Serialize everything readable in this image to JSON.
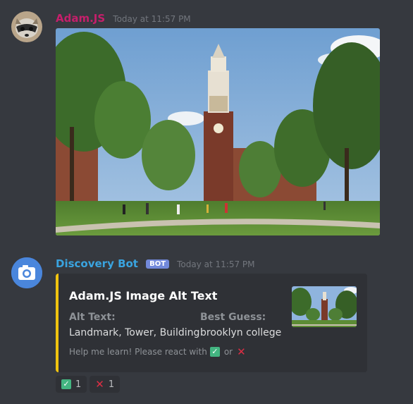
{
  "messages": [
    {
      "username": "Adam.JS",
      "username_color": "#c51f6b",
      "timestamp": "Today at 11:57 PM"
    },
    {
      "username": "Discovery Bot",
      "username_color": "#3aa4e0",
      "badge": "BOT",
      "timestamp": "Today at 11:57 PM",
      "embed": {
        "accent_color": "#f1c40f",
        "title": "Adam.JS Image Alt Text",
        "fields": [
          {
            "name": "Alt Text:",
            "value": "Landmark, Tower, Building"
          },
          {
            "name": "Best Guess:",
            "value": "brooklyn college"
          }
        ],
        "footer_text": "Help me learn! Please react with",
        "footer_or": "or"
      },
      "reactions": [
        {
          "emoji": "check-mark-emoji",
          "count": "1"
        },
        {
          "emoji": "cross-mark-emoji",
          "count": "1"
        }
      ]
    }
  ],
  "theme": {
    "background": "#36393f",
    "embed_background": "#2f3136",
    "bot_badge": "#7289da"
  }
}
